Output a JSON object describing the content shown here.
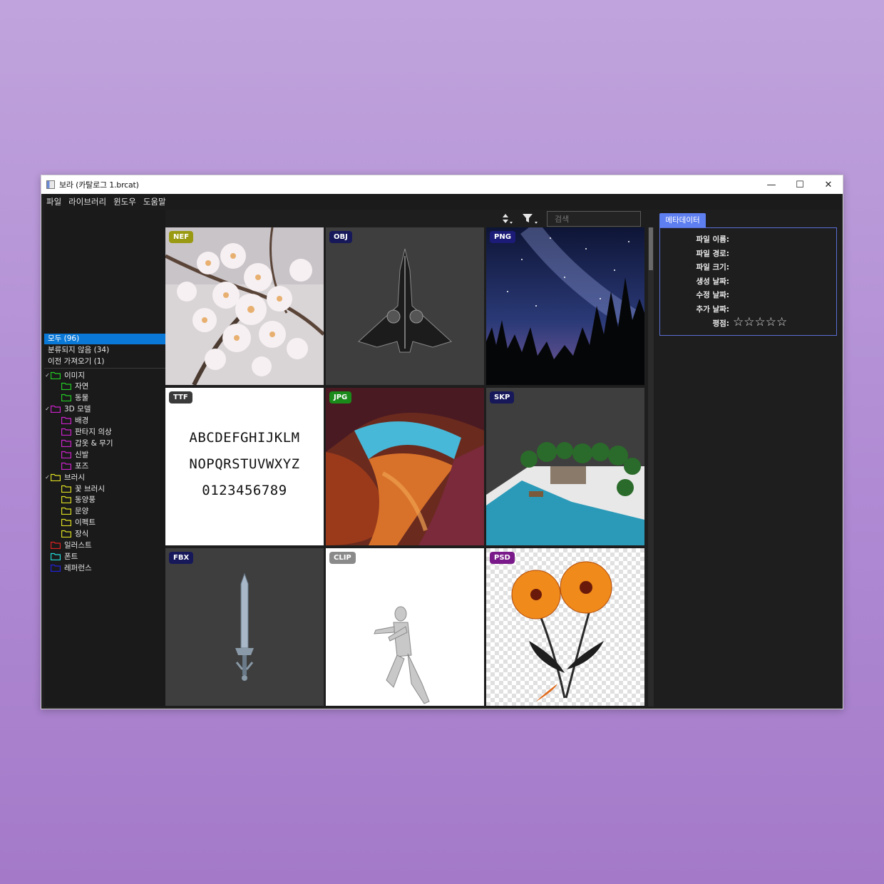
{
  "window": {
    "title": "보라 (카탈로그 1.brcat)",
    "controls": {
      "minimize": "—",
      "maximize": "☐",
      "close": "✕"
    }
  },
  "menu": [
    "파일",
    "라이브러리",
    "윈도우",
    "도움말"
  ],
  "filters": [
    {
      "label": "모두 (96)",
      "selected": true
    },
    {
      "label": "분류되지 않음 (34)",
      "selected": false
    },
    {
      "label": "이전 가져오기 (1)",
      "selected": false
    }
  ],
  "tree": [
    {
      "label": "이미지",
      "level": 0,
      "expanded": true,
      "color": "#22cc22"
    },
    {
      "label": "자연",
      "level": 1,
      "color": "#22cc22"
    },
    {
      "label": "동물",
      "level": 1,
      "color": "#22cc22"
    },
    {
      "label": "3D 모델",
      "level": 0,
      "expanded": true,
      "color": "#cc22cc"
    },
    {
      "label": "배경",
      "level": 1,
      "color": "#cc22cc"
    },
    {
      "label": "판타지 의상",
      "level": 1,
      "color": "#cc22cc"
    },
    {
      "label": "갑옷 & 무기",
      "level": 1,
      "color": "#cc22cc"
    },
    {
      "label": "신발",
      "level": 1,
      "color": "#cc22cc"
    },
    {
      "label": "포즈",
      "level": 1,
      "color": "#cc22cc"
    },
    {
      "label": "브러시",
      "level": 0,
      "expanded": true,
      "color": "#dddd22"
    },
    {
      "label": "꽃 브러시",
      "level": 1,
      "color": "#dddd22"
    },
    {
      "label": "동양풍",
      "level": 1,
      "color": "#dddd22"
    },
    {
      "label": "문양",
      "level": 1,
      "color": "#dddd22"
    },
    {
      "label": "이펙트",
      "level": 1,
      "color": "#dddd22"
    },
    {
      "label": "장식",
      "level": 1,
      "color": "#dddd22"
    },
    {
      "label": "일러스트",
      "level": 0,
      "color": "#dd2222"
    },
    {
      "label": "폰트",
      "level": 0,
      "color": "#22dddd"
    },
    {
      "label": "레퍼런스",
      "level": 0,
      "color": "#2222dd"
    }
  ],
  "toolbar": {
    "sort_icon": "sort-icon",
    "filter_icon": "filter-icon",
    "search_placeholder": "검색"
  },
  "tiles": [
    {
      "badge": "NEF",
      "badge_color": "#9a9a12",
      "subject": "cherry-blossom"
    },
    {
      "badge": "OBJ",
      "badge_color": "#16185a",
      "subject": "spaceship"
    },
    {
      "badge": "PNG",
      "badge_color": "#1c1c78",
      "subject": "night-sky"
    },
    {
      "badge": "TTF",
      "badge_color": "#3a3a3a",
      "subject": "font-sample"
    },
    {
      "badge": "JPG",
      "badge_color": "#1a8a1a",
      "subject": "canyon"
    },
    {
      "badge": "SKP",
      "badge_color": "#16185a",
      "subject": "beach-resort"
    },
    {
      "badge": "FBX",
      "badge_color": "#16185a",
      "subject": "sword"
    },
    {
      "badge": "CLIP",
      "badge_color": "#8a8a8a",
      "subject": "pose-figure"
    },
    {
      "badge": "PSD",
      "badge_color": "#7a1a8a",
      "subject": "orange-flowers"
    }
  ],
  "font_sample": [
    "ABCDEFGHIJKLM",
    "NOPQRSTUVWXYZ",
    "0123456789"
  ],
  "metadata": {
    "tab_label": "메타데이터",
    "fields": [
      "파일 이름:",
      "파일 경로:",
      "파일 크기:",
      "생성 날짜:",
      "수정 날짜:",
      "추가 날짜:"
    ],
    "rating_label": "평점:",
    "rating": 0,
    "rating_max": 5
  }
}
